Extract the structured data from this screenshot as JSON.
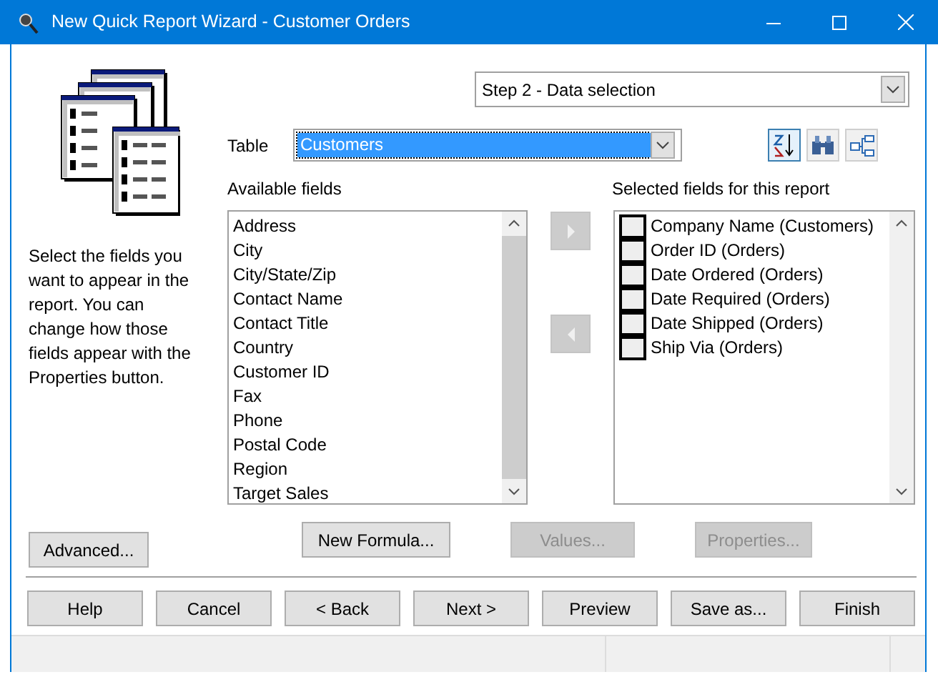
{
  "window": {
    "title": "New Quick Report Wizard - Customer Orders"
  },
  "step_selector": {
    "value": "Step 2 - Data selection"
  },
  "table_selector": {
    "label": "Table",
    "value": "Customers"
  },
  "toolbar": [
    {
      "kind": "sort",
      "selected": true
    },
    {
      "kind": "find",
      "selected": false
    },
    {
      "kind": "relations",
      "selected": false
    }
  ],
  "description": "Select the fields you want to appear in the report. You can change how those fields appear with the Properties button.",
  "available_fields": {
    "label": "Available fields",
    "items": [
      "Address",
      "City",
      "City/State/Zip",
      "Contact Name",
      "Contact Title",
      "Country",
      "Customer ID",
      "Fax",
      "Phone",
      "Postal Code",
      "Region",
      "Target Sales"
    ]
  },
  "move_buttons": [
    {
      "kind": "add",
      "disabled": true
    },
    {
      "kind": "remove",
      "disabled": true
    }
  ],
  "selected_fields": {
    "label": "Selected fields for this report",
    "items": [
      {
        "text": "Company Name (Customers)",
        "checked": false
      },
      {
        "text": "Order ID (Orders)",
        "checked": false
      },
      {
        "text": "Date Ordered (Orders)",
        "checked": false
      },
      {
        "text": "Date Required (Orders)",
        "checked": false
      },
      {
        "text": "Date Shipped (Orders)",
        "checked": false
      },
      {
        "text": "Ship Via (Orders)",
        "checked": false
      }
    ]
  },
  "advanced_button": {
    "label": "Advanced...",
    "disabled": false
  },
  "field_buttons": [
    {
      "label": "New Formula...",
      "disabled": false
    },
    {
      "label": "Values...",
      "disabled": true
    },
    {
      "label": "Properties...",
      "disabled": true
    }
  ],
  "footer_buttons": [
    {
      "label": "Help"
    },
    {
      "label": "Cancel"
    },
    {
      "label": "< Back"
    },
    {
      "label": "Next >"
    },
    {
      "label": "Preview"
    },
    {
      "label": "Save as..."
    },
    {
      "label": "Finish"
    }
  ]
}
